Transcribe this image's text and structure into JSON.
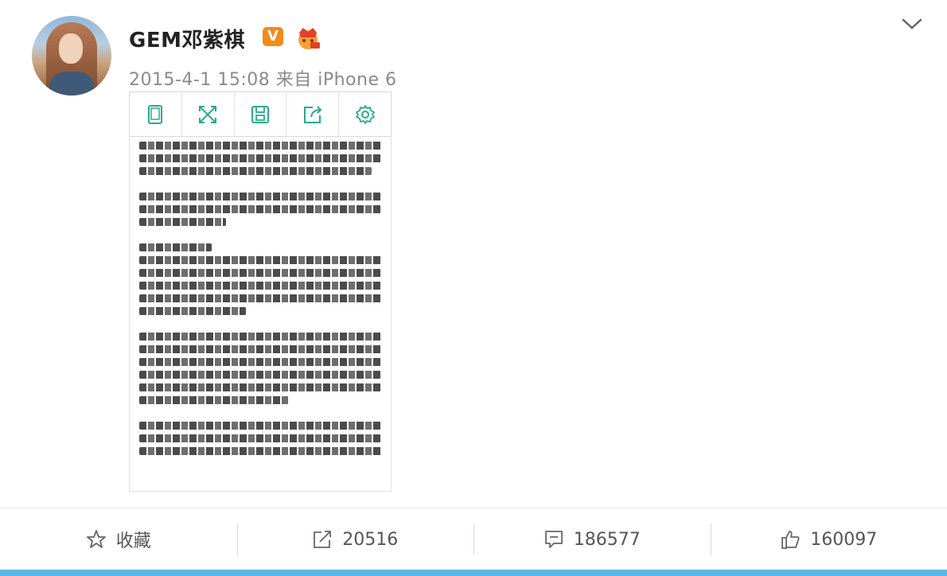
{
  "post": {
    "author": "GEM邓紫棋",
    "verified_badge": "V",
    "timestamp": "2015-4-1 15:08 来自 iPhone 6"
  },
  "toolbar": {
    "icons": [
      "tablet-icon",
      "fullscreen-icon",
      "save-icon",
      "share-icon",
      "settings-icon"
    ],
    "accent": "#2aa98e"
  },
  "actions": {
    "favorite_label": "收藏",
    "repost_count": "20516",
    "comment_count": "186577",
    "like_count": "160097"
  },
  "colors": {
    "vbadge": "#f28b1a",
    "bottom_bar": "#5ab6e6"
  }
}
